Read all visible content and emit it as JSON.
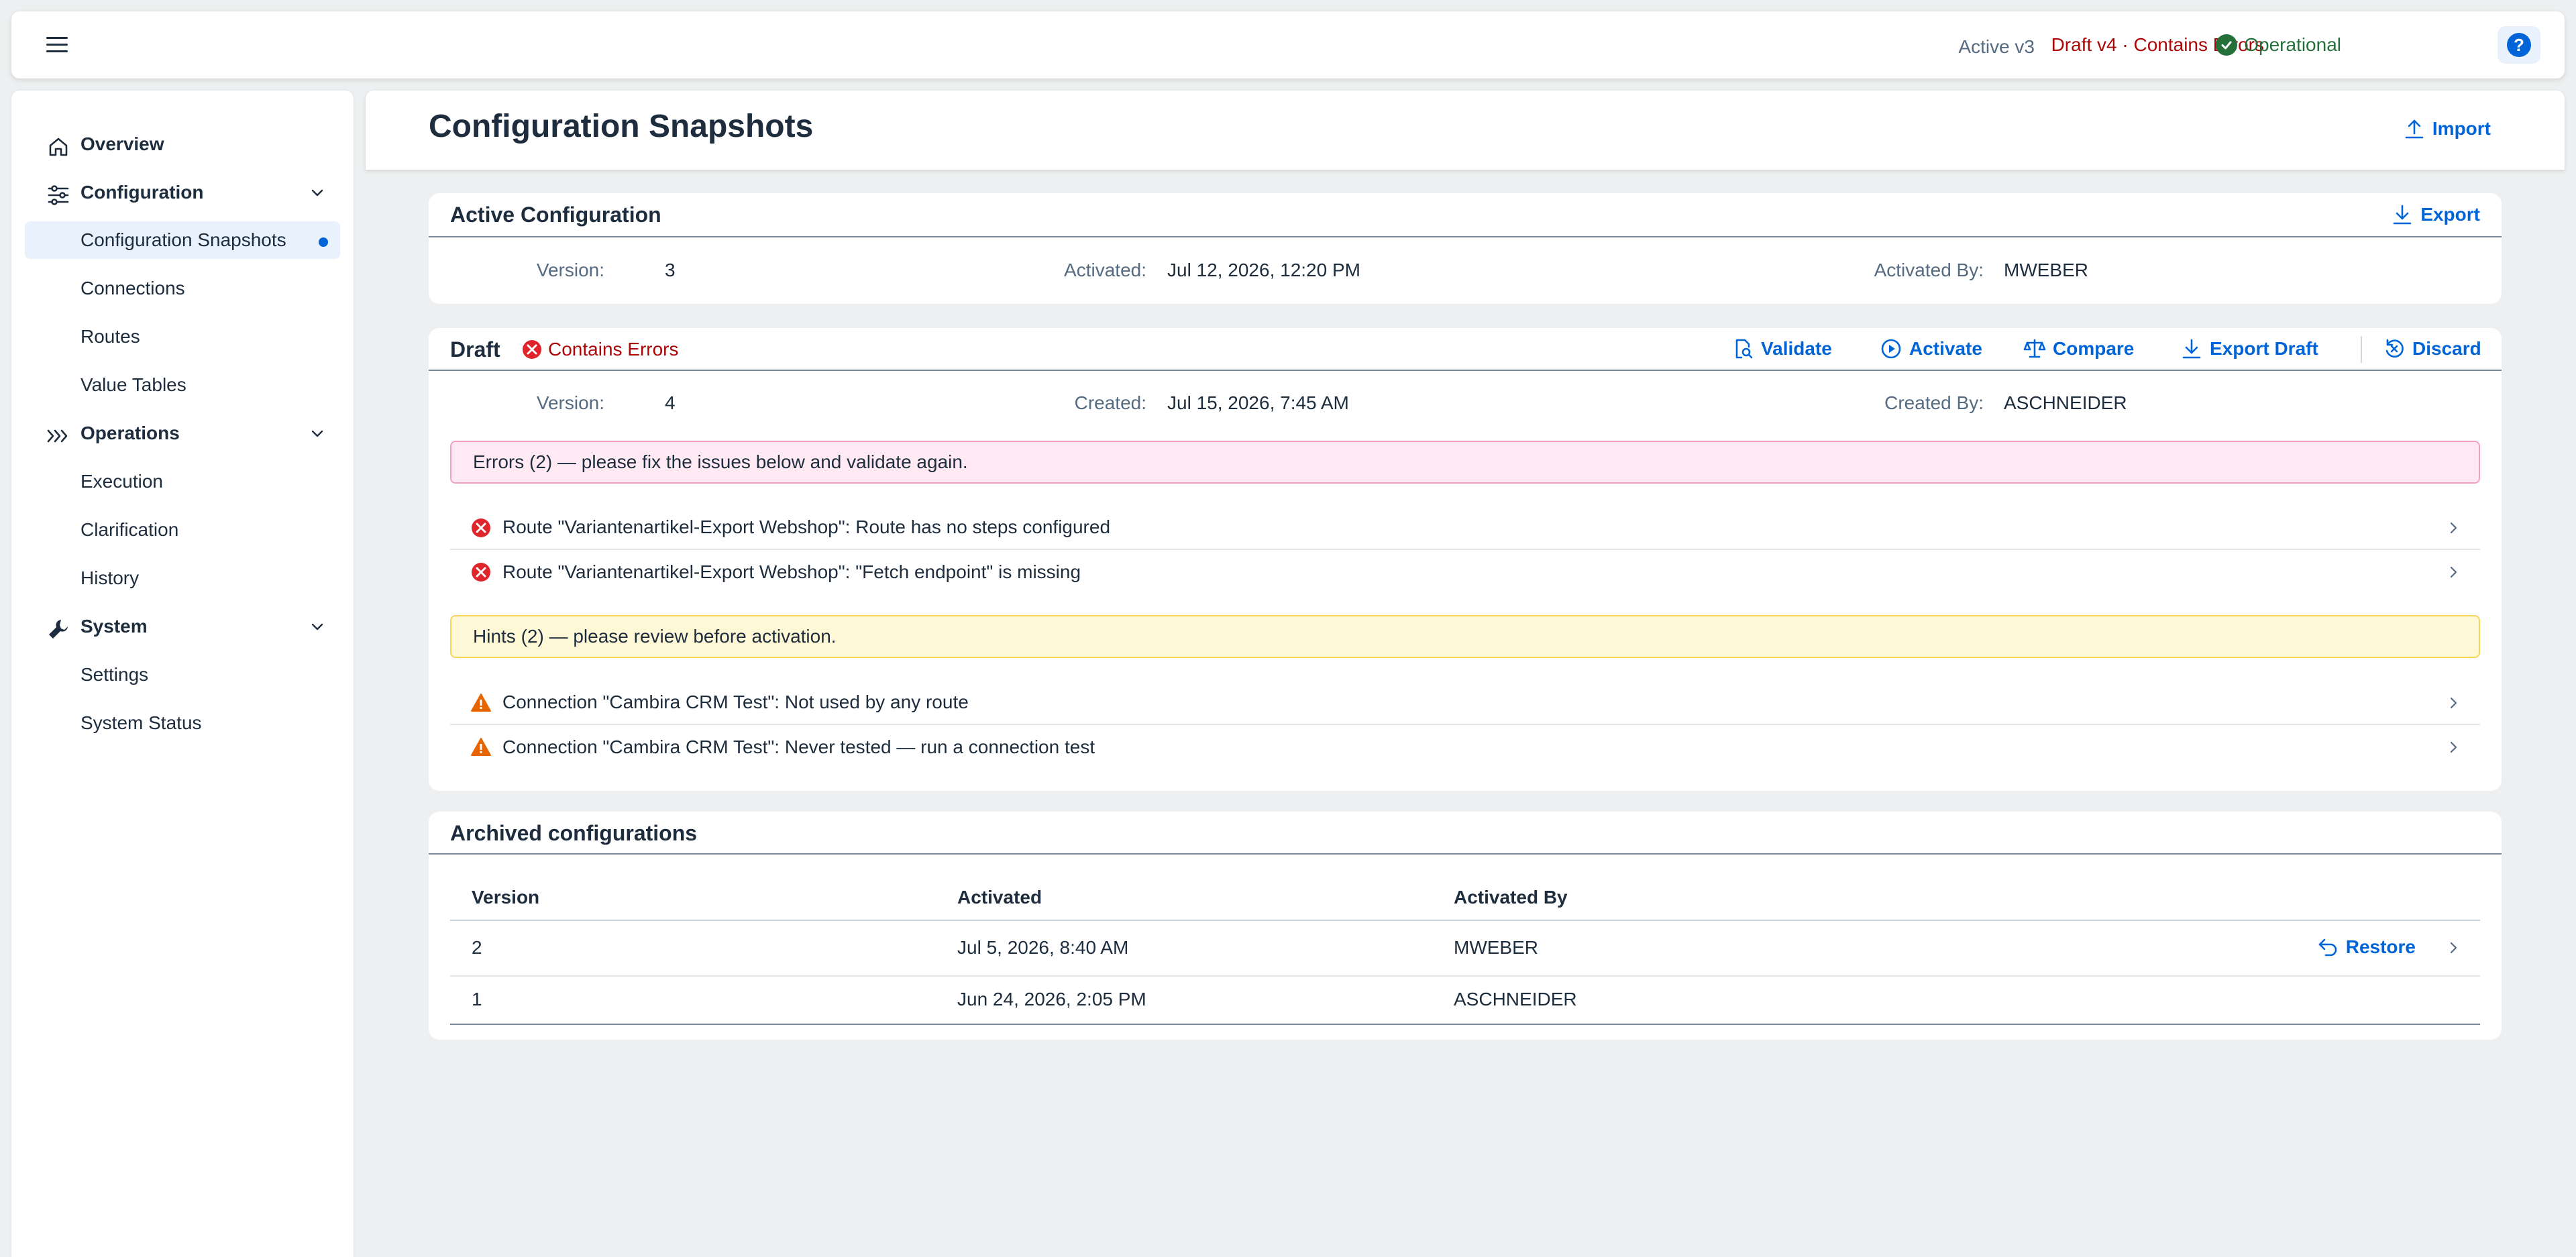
{
  "shell": {
    "menu_icon": "hamburger-icon",
    "active_version": "Active v3",
    "draft_status": "Draft v4 · Contains Errors",
    "system_status": "Operational",
    "help_label": "?"
  },
  "sidebar": {
    "items": [
      {
        "label": "Overview",
        "icon": "home-icon",
        "level": "top"
      },
      {
        "label": "Configuration",
        "icon": "sliders-icon",
        "level": "top",
        "expanded": true
      },
      {
        "label": "Configuration Snapshots",
        "level": "sub",
        "selected": true
      },
      {
        "label": "Connections",
        "level": "sub"
      },
      {
        "label": "Routes",
        "level": "sub"
      },
      {
        "label": "Value Tables",
        "level": "sub"
      },
      {
        "label": "Operations",
        "icon": "chevrons-right-icon",
        "level": "top",
        "expanded": true
      },
      {
        "label": "Execution",
        "level": "sub"
      },
      {
        "label": "Clarification",
        "level": "sub"
      },
      {
        "label": "History",
        "level": "sub"
      },
      {
        "label": "System",
        "icon": "wrench-icon",
        "level": "top",
        "expanded": true
      },
      {
        "label": "Settings",
        "level": "sub"
      },
      {
        "label": "System Status",
        "level": "sub"
      }
    ]
  },
  "header": {
    "title": "Configuration Snapshots",
    "import_label": "Import"
  },
  "active_config": {
    "title": "Active Configuration",
    "export_label": "Export",
    "version_label": "Version:",
    "version": "3",
    "activated_label": "Activated:",
    "activated": "Jul 12, 2026, 12:20 PM",
    "activated_by_label": "Activated By:",
    "activated_by": "MWEBER"
  },
  "draft": {
    "title": "Draft",
    "status": "Contains Errors",
    "actions": {
      "validate": "Validate",
      "activate": "Activate",
      "compare": "Compare",
      "export_draft": "Export Draft",
      "discard": "Discard"
    },
    "version_label": "Version:",
    "version": "4",
    "created_label": "Created:",
    "created": "Jul 15, 2026, 7:45 AM",
    "created_by_label": "Created By:",
    "created_by": "ASCHNEIDER",
    "errors_strip": "Errors (2) — please fix the issues below and validate again.",
    "errors": [
      "Route \"Variantenartikel-Export Webshop\": Route has no steps configured",
      "Route \"Variantenartikel-Export Webshop\": \"Fetch endpoint\" is missing"
    ],
    "hints_strip": "Hints (2) — please review before activation.",
    "hints": [
      "Connection \"Cambira CRM Test\": Not used by any route",
      "Connection \"Cambira CRM Test\": Never tested — run a connection test"
    ]
  },
  "archived": {
    "title": "Archived configurations",
    "columns": [
      "Version",
      "Activated",
      "Activated By"
    ],
    "rows": [
      {
        "version": "2",
        "activated": "Jul 5, 2026, 8:40 AM",
        "activated_by": "MWEBER",
        "action": "Restore"
      },
      {
        "version": "1",
        "activated": "Jun 24, 2026, 2:05 PM",
        "activated_by": "ASCHNEIDER",
        "action": ""
      }
    ]
  },
  "colors": {
    "accent": "#0064d9",
    "error": "#aa0808",
    "error_icon": "#e0242b",
    "warning_icon": "#e76500",
    "success": "#256f3a"
  }
}
